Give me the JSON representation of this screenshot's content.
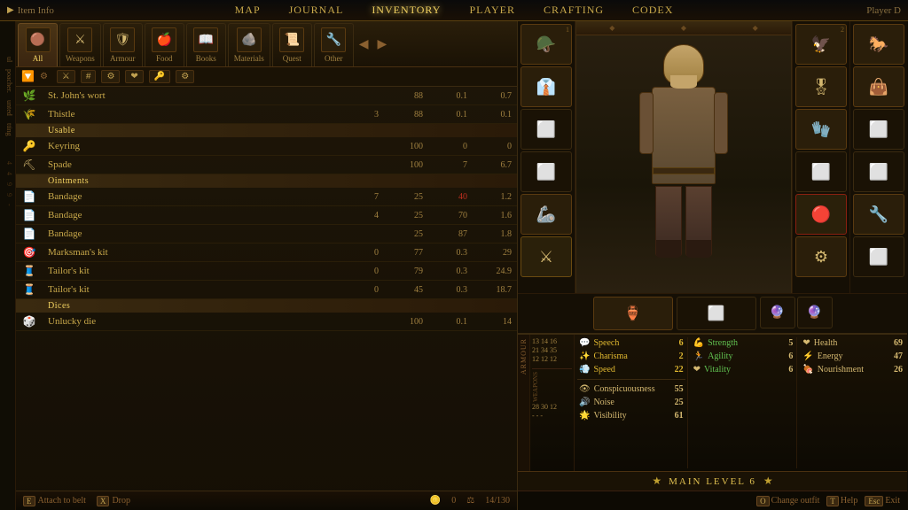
{
  "topnav": {
    "left_label": "Item Info",
    "items": [
      {
        "label": "MAP"
      },
      {
        "label": "JOURNAL"
      },
      {
        "label": "INVENTORY"
      },
      {
        "label": "PLAYER"
      },
      {
        "label": "CRAFTING"
      },
      {
        "label": "CODEX"
      }
    ],
    "active_index": 2,
    "right_label": "Player D"
  },
  "categories": [
    {
      "label": "All",
      "icon": "🟤",
      "active": true
    },
    {
      "label": "Weapons",
      "icon": "⚔️",
      "active": false
    },
    {
      "label": "Armour",
      "icon": "🛡",
      "active": false
    },
    {
      "label": "Food",
      "icon": "🍎",
      "active": false
    },
    {
      "label": "Books",
      "icon": "📖",
      "active": false
    },
    {
      "label": "Materials",
      "icon": "🪨",
      "active": false
    },
    {
      "label": "Quest",
      "icon": "📜",
      "active": false
    },
    {
      "label": "Other",
      "icon": "🔧",
      "active": false
    }
  ],
  "items": [
    {
      "icon": "🌿",
      "name": "St. John's wort",
      "qty": "",
      "weight": "88",
      "val1": "0.1",
      "val2": "0.7",
      "category": null
    },
    {
      "icon": "🌾",
      "name": "Thistle",
      "qty": "3",
      "weight": "88",
      "val1": "0.1",
      "val2": "0.1",
      "category": null
    },
    {
      "icon": null,
      "name": "Usable",
      "qty": "",
      "weight": "",
      "val1": "",
      "val2": "",
      "category": "Usable"
    },
    {
      "icon": "🔑",
      "name": "Keyring",
      "qty": "",
      "weight": "100",
      "val1": "0",
      "val2": "0",
      "category": null
    },
    {
      "icon": "⛏",
      "name": "Spade",
      "qty": "",
      "weight": "100",
      "val1": "7",
      "val2": "6.7",
      "category": null
    },
    {
      "icon": null,
      "name": "Ointments",
      "qty": "",
      "weight": "",
      "val1": "",
      "val2": "",
      "category": "Ointments"
    },
    {
      "icon": "🩹",
      "name": "Bandage",
      "qty": "7",
      "weight": "25",
      "val1": "40",
      "val2": "1.2",
      "red": true,
      "category": null
    },
    {
      "icon": "🩹",
      "name": "Bandage",
      "qty": "4",
      "weight": "25",
      "val1": "70",
      "val2": "1.6",
      "category": null
    },
    {
      "icon": "🩹",
      "name": "Bandage",
      "qty": "",
      "weight": "25",
      "val1": "87",
      "val2": "1.8",
      "category": null
    },
    {
      "icon": "🎯",
      "name": "Marksman's kit",
      "qty": "0",
      "weight": "77",
      "val1": "0.3",
      "val2": "29",
      "category": null
    },
    {
      "icon": "🧵",
      "name": "Tailor's kit",
      "qty": "0",
      "weight": "79",
      "val1": "0.3",
      "val2": "24.9",
      "category": null
    },
    {
      "icon": "🧵",
      "name": "Tailor's kit",
      "qty": "0",
      "weight": "45",
      "val1": "0.3",
      "val2": "18.7",
      "category": null
    },
    {
      "icon": null,
      "name": "Dices",
      "qty": "",
      "weight": "",
      "val1": "",
      "val2": "",
      "category": "Dices"
    },
    {
      "icon": "🎲",
      "name": "Unlucky die",
      "qty": "",
      "weight": "100",
      "val1": "0.1",
      "val2": "14",
      "category": null
    }
  ],
  "bottom_bar": {
    "gold": "0",
    "weight": "14/130",
    "actions": [
      {
        "key": "E",
        "label": "Attach to belt"
      },
      {
        "key": "X",
        "label": "Drop"
      }
    ]
  },
  "stats": {
    "speech": {
      "label": "Speech",
      "value": 6
    },
    "charisma": {
      "label": "Charisma",
      "value": 2
    },
    "speed": {
      "label": "Speed",
      "value": 22
    },
    "conspicuousness": {
      "label": "Conspicuousness",
      "value": 55
    },
    "noise": {
      "label": "Noise",
      "value": 25
    },
    "visibility": {
      "label": "Visibility",
      "value": 61
    },
    "strength": {
      "label": "Strength",
      "value": 5
    },
    "agility": {
      "label": "Agility",
      "value": 6
    },
    "vitality": {
      "label": "Vitality",
      "value": 6
    },
    "health": {
      "label": "Health",
      "value": 69
    },
    "energy": {
      "label": "Energy",
      "value": 47
    },
    "nourishment": {
      "label": "Nourishment",
      "value": 26
    }
  },
  "armour_vals": {
    "rows": [
      [
        "13",
        "14",
        "16"
      ],
      [
        "21",
        "34",
        "35"
      ],
      [
        "12",
        "12",
        "12"
      ]
    ]
  },
  "weapon_vals": {
    "rows": [
      [
        "28",
        "30",
        "12"
      ],
      [
        "-",
        "-",
        "-"
      ]
    ]
  },
  "main_level": {
    "label": "MAIN LEVEL 6"
  },
  "bottom_nav": {
    "items": [
      {
        "key": "O",
        "label": "Change outfit"
      },
      {
        "key": "T",
        "label": "Help"
      },
      {
        "key": "Esc",
        "label": "Exit"
      }
    ]
  }
}
